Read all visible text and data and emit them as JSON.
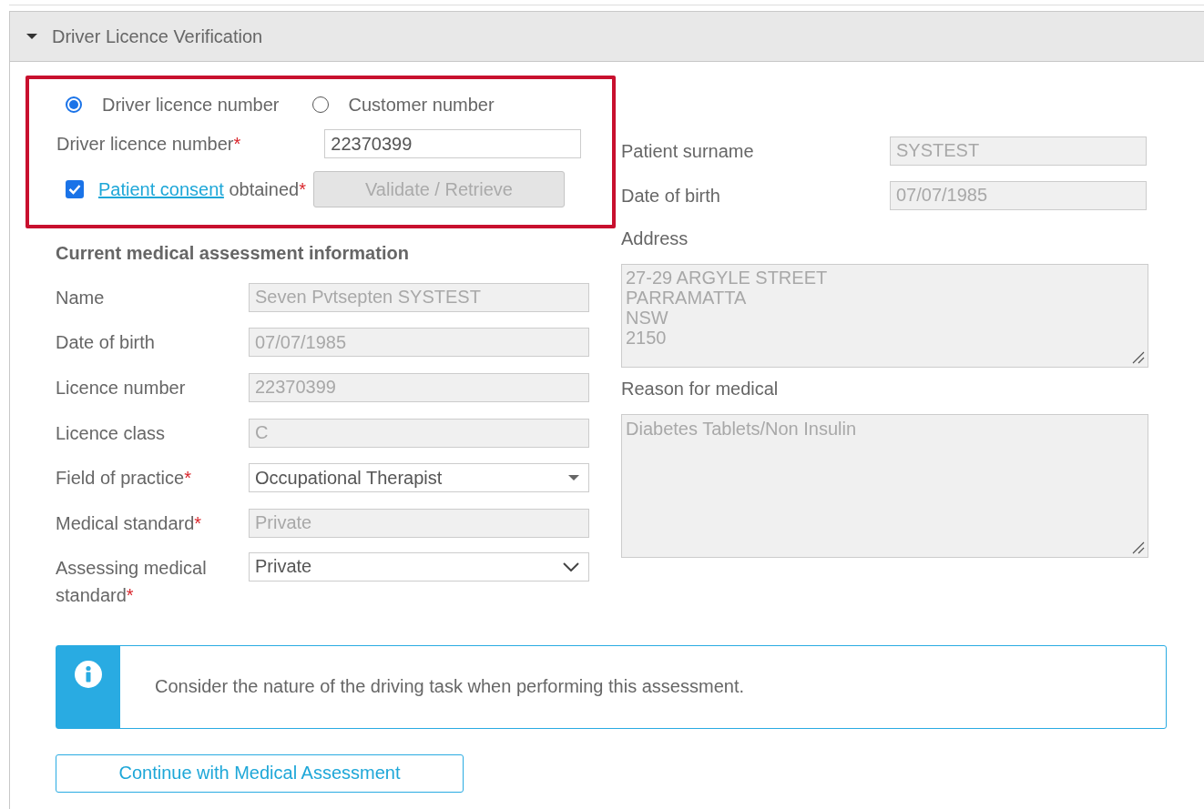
{
  "panel": {
    "title": "Driver Licence Verification",
    "expanded": true
  },
  "lookup": {
    "options": [
      {
        "label": "Driver licence number",
        "selected": true
      },
      {
        "label": "Customer number",
        "selected": false
      }
    ],
    "field": {
      "label": "Driver licence number",
      "required_mark": "*",
      "value": "22370399"
    },
    "consent": {
      "checked": true,
      "link": "Patient consent",
      "text": "obtained",
      "required_mark": "*"
    },
    "button": {
      "label": "Validate / Retrieve",
      "disabled": true
    }
  },
  "patient": [
    {
      "label": "Patient surname",
      "value": "SYSTEST"
    },
    {
      "label": "Date of birth",
      "value": "07/07/1985"
    }
  ],
  "assessment": {
    "heading": "Current medical assessment information",
    "fields": [
      {
        "label": "Name",
        "value": "Seven Pvtsepten SYSTEST",
        "kind": "readonly"
      },
      {
        "label": "Date of birth",
        "value": "07/07/1985",
        "kind": "readonly"
      },
      {
        "label": "Licence number",
        "value": "22370399",
        "kind": "readonly"
      },
      {
        "label": "Licence class",
        "value": "C",
        "kind": "readonly"
      },
      {
        "label": "Field of practice",
        "required_mark": "*",
        "value": "Occupational Therapist",
        "kind": "dropdown"
      },
      {
        "label": "Medical standard",
        "required_mark": "*",
        "value": "Private",
        "kind": "readonly"
      },
      {
        "label": "Assessing medical standard",
        "required_mark": "*",
        "value": "Private",
        "kind": "select"
      }
    ]
  },
  "address": {
    "label": "Address",
    "value": "27-29 ARGYLE STREET\nPARRAMATTA\nNSW\n2150"
  },
  "reason": {
    "label": "Reason for medical",
    "value": "Diabetes Tablets/Non Insulin"
  },
  "notice": {
    "text": "Consider the nature of the driving task when performing this assessment."
  },
  "continue_button": {
    "label": "Continue with Medical Assessment"
  }
}
